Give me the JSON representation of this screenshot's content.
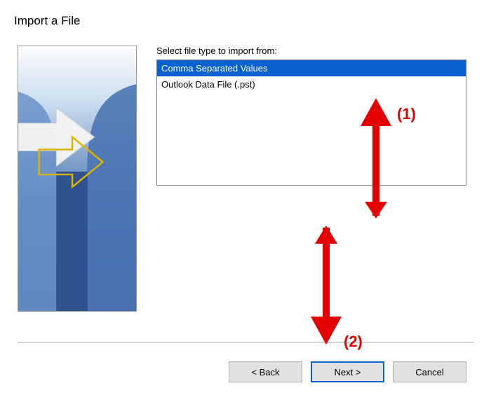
{
  "dialog": {
    "title": "Import a File"
  },
  "content": {
    "listLabel": "Select file type to import from:",
    "fileTypes": [
      {
        "label": "Comma Separated Values",
        "selected": true
      },
      {
        "label": "Outlook Data File (.pst)",
        "selected": false
      }
    ]
  },
  "buttons": {
    "back": "< Back",
    "next": "Next >",
    "cancel": "Cancel"
  },
  "annotations": {
    "label1": "(1)",
    "label2": "(2)",
    "color": "#e20000"
  }
}
